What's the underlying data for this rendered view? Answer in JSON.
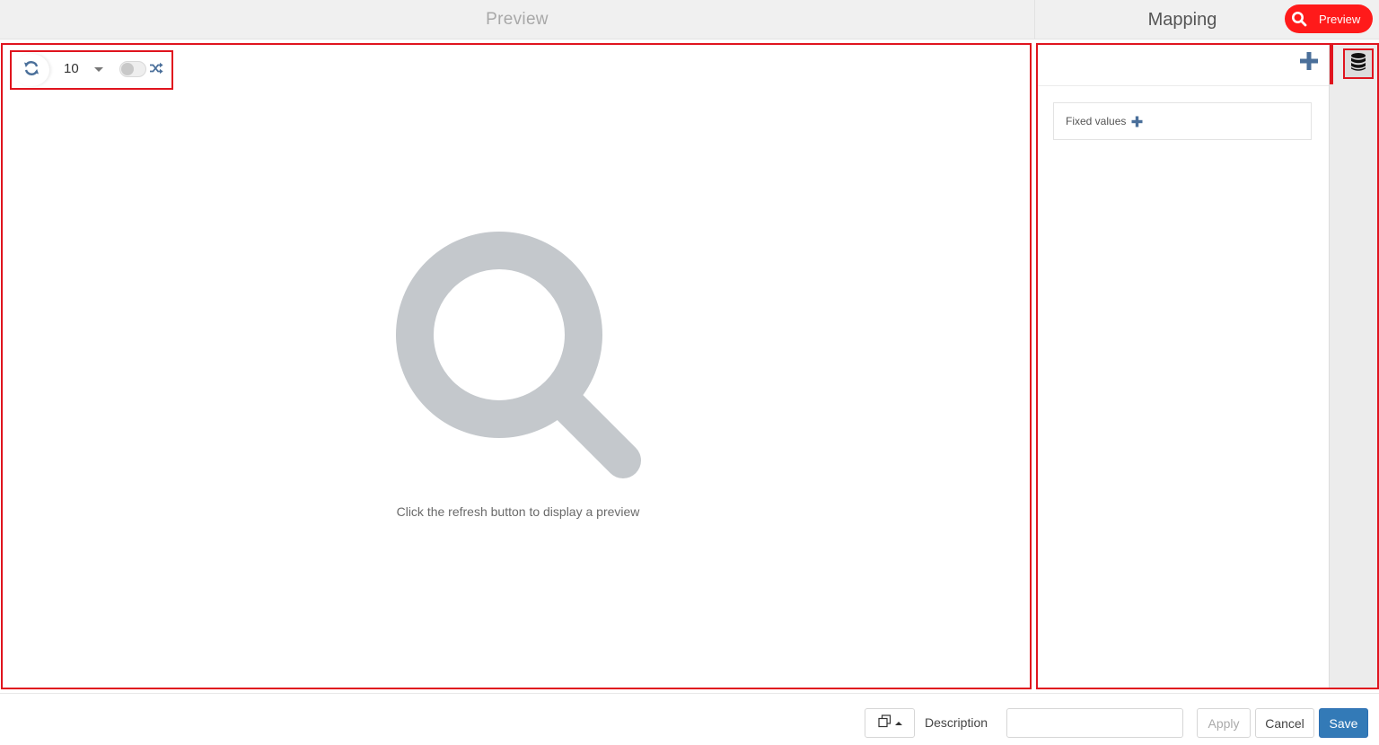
{
  "header": {
    "preview_title": "Preview",
    "mapping_title": "Mapping",
    "preview_button_label": "Preview"
  },
  "toolbar": {
    "sample_count": "10"
  },
  "preview": {
    "empty_message": "Click the refresh button to display a preview"
  },
  "mapping": {
    "fixed_values_label": "Fixed values"
  },
  "footer": {
    "description_label": "Description",
    "description_value": "",
    "apply_label": "Apply",
    "cancel_label": "Cancel",
    "save_label": "Save"
  },
  "icons": {
    "refresh": "refresh-icon",
    "shuffle": "shuffle-icon",
    "search": "search-icon",
    "plus": "plus-icon",
    "database": "database-icon",
    "copy": "copy-icon"
  },
  "colors": {
    "highlight_red": "#e0141e",
    "preview_pill": "#ff1a1a",
    "icon_blue": "#4a6f9a",
    "primary_blue": "#337ab7",
    "illustration_gray": "#c4c8cc"
  }
}
